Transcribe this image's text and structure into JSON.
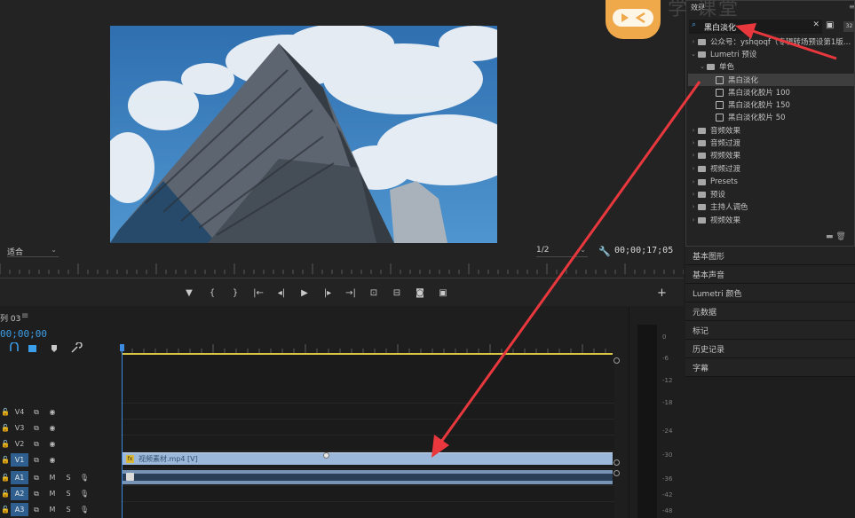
{
  "monitor": {
    "fit_label": "适合",
    "resolution_label": "1/2",
    "timecode": "00;00;17;05",
    "transport": [
      "marker",
      "in",
      "out",
      "go-to-in",
      "step-back",
      "play",
      "step-forward",
      "go-to-out",
      "lift",
      "extract",
      "export-frame",
      "compare"
    ],
    "add_label": "+"
  },
  "timeline": {
    "sequence_tab": "列 03",
    "timecode": "00;00;00",
    "tracks": [
      {
        "name": "V4",
        "type": "video"
      },
      {
        "name": "V3",
        "type": "video"
      },
      {
        "name": "V2",
        "type": "video"
      },
      {
        "name": "V1",
        "type": "video",
        "active": true
      },
      {
        "name": "A1",
        "type": "audio",
        "active": true
      },
      {
        "name": "A2",
        "type": "audio",
        "active": true
      },
      {
        "name": "A3",
        "type": "audio",
        "active": true
      }
    ],
    "audio_toggles": {
      "mute": "M",
      "solo": "S"
    },
    "video_clip_name": "视频素材.mp4 [V]",
    "fx_badge": "fx"
  },
  "meter": {
    "ticks": [
      "0",
      "-6",
      "-12",
      "-18",
      "-24",
      "-30",
      "-36",
      "-42",
      "-48"
    ]
  },
  "effects": {
    "title": "效果",
    "search_value": "黑白淡化",
    "badge": "32",
    "items": [
      {
        "label": "公众号：yshqoqf（专辑转场预设第1版…",
        "level": 0,
        "kind": "folder",
        "expanded": false
      },
      {
        "label": "Lumetri 预设",
        "level": 0,
        "kind": "folder",
        "expanded": true
      },
      {
        "label": "单色",
        "level": 1,
        "kind": "folder",
        "expanded": true
      },
      {
        "label": "黑白淡化",
        "level": 2,
        "kind": "preset",
        "selected": true
      },
      {
        "label": "黑白淡化胶片 100",
        "level": 2,
        "kind": "preset"
      },
      {
        "label": "黑白淡化胶片 150",
        "level": 2,
        "kind": "preset"
      },
      {
        "label": "黑白淡化胶片 50",
        "level": 2,
        "kind": "preset"
      },
      {
        "label": "音频效果",
        "level": 0,
        "kind": "folder",
        "expanded": false
      },
      {
        "label": "音频过渡",
        "level": 0,
        "kind": "folder",
        "expanded": false
      },
      {
        "label": "视频效果",
        "level": 0,
        "kind": "folder",
        "expanded": false
      },
      {
        "label": "视频过渡",
        "level": 0,
        "kind": "folder",
        "expanded": false
      },
      {
        "label": "Presets",
        "level": 0,
        "kind": "folder",
        "expanded": false
      },
      {
        "label": "预设",
        "level": 0,
        "kind": "folder",
        "expanded": false
      },
      {
        "label": "主持人调色",
        "level": 0,
        "kind": "folder",
        "expanded": false
      },
      {
        "label": "视频效果",
        "level": 0,
        "kind": "folder",
        "expanded": false
      }
    ]
  },
  "side_panels": [
    "基本图形",
    "基本声音",
    "Lumetri 颜色",
    "元数据",
    "标记",
    "历史记录",
    "字幕"
  ],
  "watermark": "学 课堂",
  "colors": {
    "accent": "#3c9ee8",
    "annotation_arrow": "#e8383d",
    "clip_video": "#9bb7d9",
    "clip_audio": "#7793b5",
    "work_area": "#d9c443",
    "logo": "#f0a94a"
  }
}
